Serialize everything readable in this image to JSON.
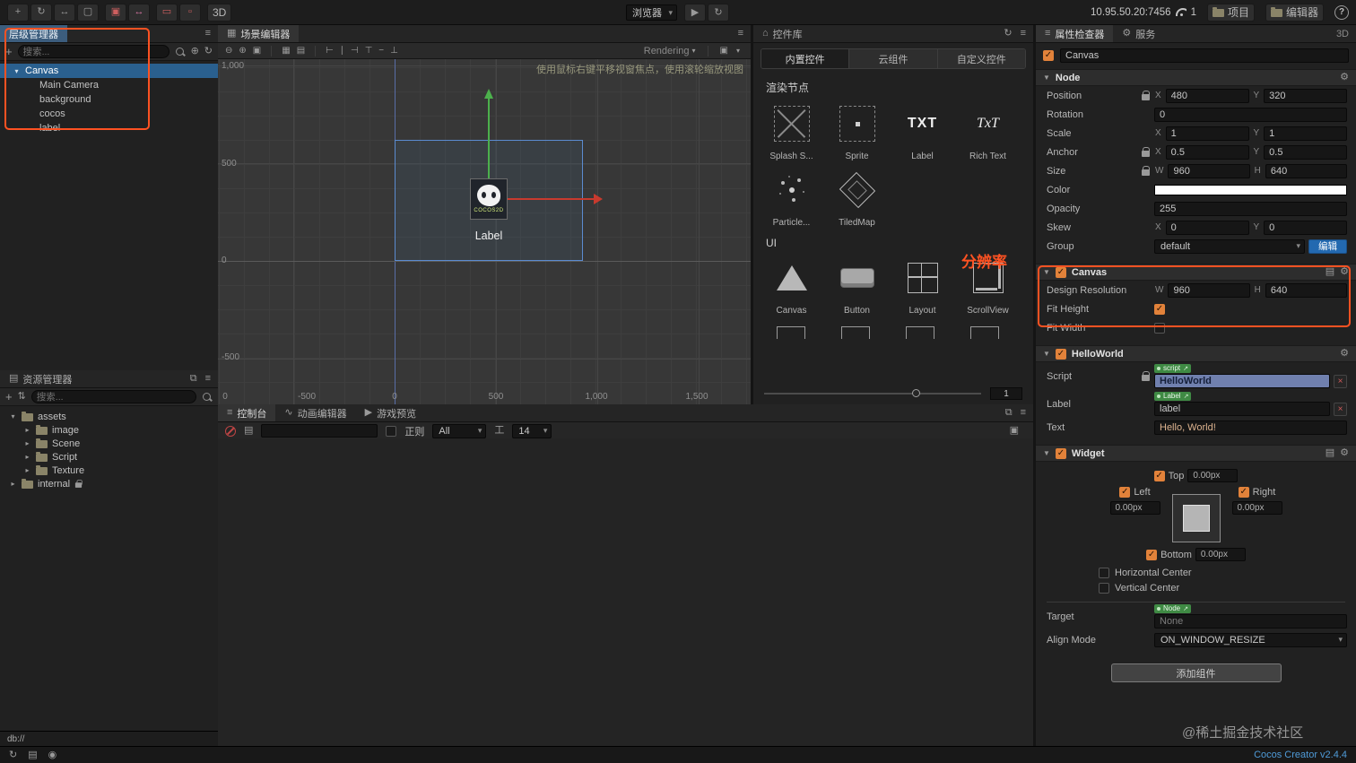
{
  "topbar": {
    "mode_3d": "3D",
    "browser": "浏览器",
    "address": "10.95.50.20:7456",
    "signal_count": "1",
    "project_btn": "项目",
    "editor_btn": "编辑器",
    "help": "?"
  },
  "hierarchy": {
    "title": "层级管理器",
    "search_placeholder": "搜索...",
    "root": "Canvas",
    "children": [
      "Main Camera",
      "background",
      "cocos",
      "label"
    ]
  },
  "assets": {
    "title": "资源管理器",
    "search_placeholder": "搜索...",
    "root": "assets",
    "folders": [
      "image",
      "Scene",
      "Script",
      "Texture"
    ],
    "internal": "internal",
    "footer": "db://"
  },
  "scene": {
    "tab": "场景编辑器",
    "hint": "使用鼠标右键平移视窗焦点，使用滚轮缩放视图",
    "rendering": "Rendering",
    "ruler_y": [
      "1,000",
      "500",
      "0",
      "-500"
    ],
    "ruler_x_corner": "0",
    "ruler_x": [
      "-500",
      "0",
      "500",
      "1,000",
      "1,500"
    ],
    "node_label": "Label",
    "logo_text": "COCOS2D"
  },
  "library": {
    "title": "控件库",
    "tabs": [
      "内置控件",
      "云组件",
      "自定义控件"
    ],
    "render_section": "渲染节点",
    "render_labels": [
      "Splash S...",
      "Sprite",
      "Label",
      "Rich Text",
      "Particle...",
      "TiledMap"
    ],
    "icon_txt": "TXT",
    "icon_richtxt": "TxT",
    "ui_section": "UI",
    "ui_labels": [
      "Canvas",
      "Button",
      "Layout",
      "ScrollView"
    ],
    "zoom_value": "1"
  },
  "console": {
    "tabs": [
      "控制台",
      "动画编辑器",
      "游戏预览"
    ],
    "regex_label": "正则",
    "filter_value": "All",
    "fontsize_value": "14"
  },
  "inspector": {
    "tab_properties": "属性检查器",
    "tab_services": "服务",
    "mode": "3D",
    "node_name": "Canvas",
    "axes": {
      "x": "X",
      "y": "Y",
      "w": "W",
      "h": "H"
    },
    "node_section": {
      "title": "Node",
      "position": {
        "label": "Position",
        "x": "480",
        "y": "320"
      },
      "rotation": {
        "label": "Rotation",
        "value": "0"
      },
      "scale": {
        "label": "Scale",
        "x": "1",
        "y": "1"
      },
      "anchor": {
        "label": "Anchor",
        "x": "0.5",
        "y": "0.5"
      },
      "size": {
        "label": "Size",
        "w": "960",
        "h": "640"
      },
      "color": {
        "label": "Color"
      },
      "opacity": {
        "label": "Opacity",
        "value": "255"
      },
      "skew": {
        "label": "Skew",
        "x": "0",
        "y": "0"
      },
      "group": {
        "label": "Group",
        "value": "default",
        "edit_btn": "编辑"
      }
    },
    "canvas_section": {
      "title": "Canvas",
      "design_resolution": {
        "label": "Design Resolution",
        "w": "960",
        "h": "640"
      },
      "fit_height": "Fit Height",
      "fit_width": "Fit Width"
    },
    "script_section": {
      "title": "HelloWorld",
      "script": {
        "label": "Script",
        "badge": "script",
        "value": "HelloWorld"
      },
      "label": {
        "label": "Label",
        "badge": "Label",
        "value": "label"
      },
      "text": {
        "label": "Text",
        "value": "Hello, World!"
      }
    },
    "widget_section": {
      "title": "Widget",
      "top": {
        "label": "Top",
        "value": "0.00px"
      },
      "left": {
        "label": "Left",
        "value": "0.00px"
      },
      "right": {
        "label": "Right",
        "value": "0.00px"
      },
      "bottom": {
        "label": "Bottom",
        "value": "0.00px"
      },
      "h_center": "Horizontal Center",
      "v_center": "Vertical Center",
      "target": {
        "label": "Target",
        "badge": "Node",
        "value": "None"
      },
      "align_mode": {
        "label": "Align Mode",
        "value": "ON_WINDOW_RESIZE"
      }
    },
    "add_component": "添加组件"
  },
  "annotations": {
    "resolution": "分辨率"
  },
  "statusbar": {
    "version": "Cocos Creator v2.4.4"
  },
  "watermark": "@稀土掘金技术社区",
  "icons": {
    "menu": "≡",
    "gear": "⚙",
    "doc": "▤",
    "refresh": "↻",
    "play": "▶",
    "dropdown": "▾",
    "check": "✓",
    "close": "×",
    "help": "?",
    "search": "css-magnifier",
    "lock": "css-lock",
    "wifi": "css-wifi",
    "folder": "css-folder",
    "ban": "css-ban"
  }
}
